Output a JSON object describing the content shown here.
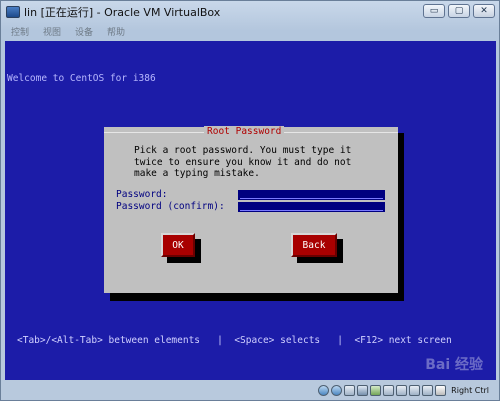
{
  "window": {
    "title": "lin [正在运行] - Oracle VM VirtualBox",
    "buttons": {
      "minimize": "▭",
      "maximize": "▢",
      "close": "✕"
    }
  },
  "menubar": {
    "items": [
      "控制",
      "视图",
      "设备",
      "帮助"
    ]
  },
  "screen": {
    "welcome": "Welcome to CentOS for i386",
    "dialog": {
      "title": "Root Password",
      "message": "Pick a root password. You must type it\ntwice to ensure you know it and do not\nmake a typing mistake.",
      "password_label": "Password:",
      "password_value": "",
      "confirm_label": "Password (confirm):",
      "confirm_value": "",
      "ok_label": "OK",
      "back_label": "Back"
    },
    "hint": "<Tab>/<Alt-Tab> between elements   |  <Space> selects   |  <F12> next screen"
  },
  "statusbar": {
    "icons": [
      "disk-icon",
      "cdrom-icon",
      "floppy-icon",
      "network-icon",
      "usb-icon",
      "shared-folder-icon",
      "display-icon",
      "capture-icon",
      "mouse-icon",
      "keyboard-icon"
    ],
    "host_key": "Right Ctrl"
  },
  "watermark": "Bai 经验"
}
